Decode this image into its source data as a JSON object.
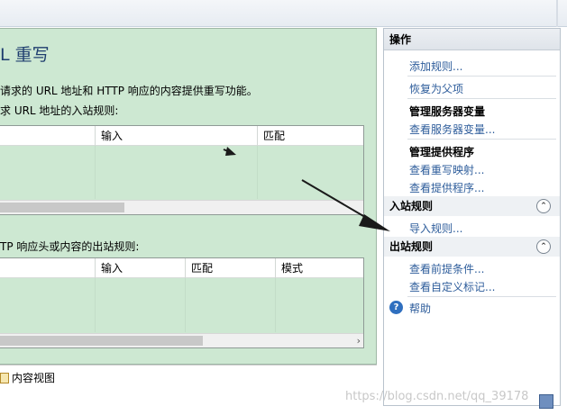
{
  "page": {
    "title": "L 重写",
    "description": "请求的 URL 地址和 HTTP 响应的内容提供重写功能。",
    "inbound_label": "求 URL 地址的入站规则:",
    "outbound_label": "TP 响应头或内容的出站规则:"
  },
  "inbound_table": {
    "columns": [
      "输入",
      "匹配"
    ]
  },
  "outbound_table": {
    "columns": [
      "输入",
      "匹配",
      "模式"
    ]
  },
  "scroll_arrow": "›",
  "viewbar": {
    "content_view": "内容视图"
  },
  "actions": {
    "header": "操作",
    "add_rule": "添加规则...",
    "revert_parent": "恢复为父项",
    "manage_server_vars_title": "管理服务器变量",
    "view_server_vars": "查看服务器变量...",
    "manage_providers_title": "管理提供程序",
    "view_rewrite_maps": "查看重写映射...",
    "view_providers": "查看提供程序...",
    "inbound_group": "入站规则",
    "import_rules": "导入规则...",
    "outbound_group": "出站规则",
    "view_preconditions": "查看前提条件...",
    "view_custom_tags": "查看自定义标记...",
    "help": "帮助",
    "collapse_glyph": "⌃"
  },
  "icons": {
    "help": "?"
  },
  "watermark": "https://blog.csdn.net/qq_39178"
}
